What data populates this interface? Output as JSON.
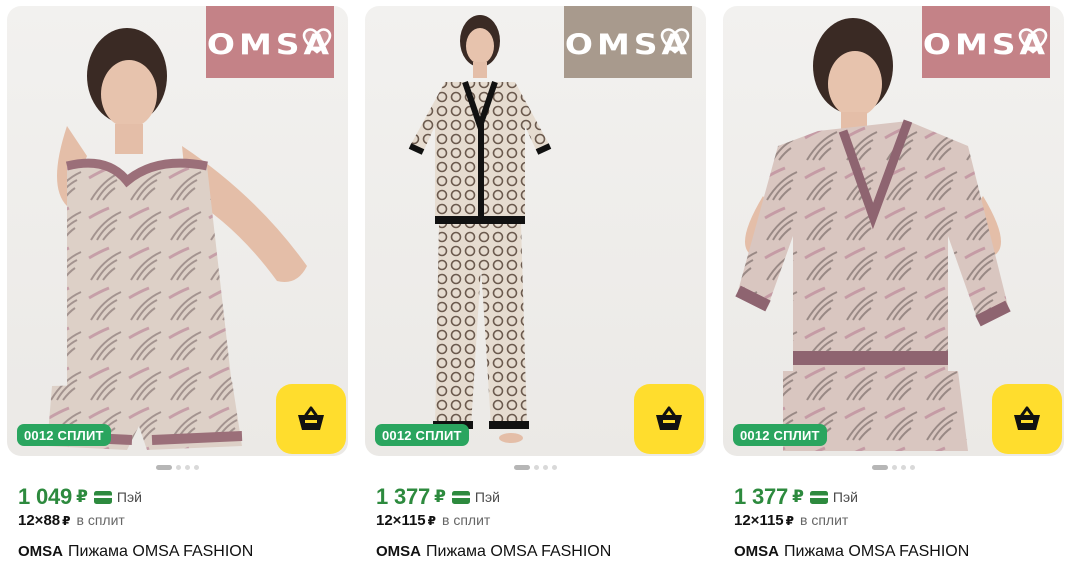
{
  "products": [
    {
      "brand_logo_text": "OMSA",
      "badge_color": "#c48287",
      "split_badge": "0012 СПЛИТ",
      "price": "1 049",
      "currency": "₽",
      "pay_label": "Пэй",
      "split_amount": "12×88",
      "split_currency": "₽",
      "split_text": "в сплит",
      "brand": "OMSA",
      "title": "Пижама OMSA FASHION"
    },
    {
      "brand_logo_text": "OMSA",
      "badge_color": "#a89a8d",
      "split_badge": "0012 СПЛИТ",
      "price": "1 377",
      "currency": "₽",
      "pay_label": "Пэй",
      "split_amount": "12×115",
      "split_currency": "₽",
      "split_text": "в сплит",
      "brand": "OMSA",
      "title": "Пижама OMSA FASHION"
    },
    {
      "brand_logo_text": "OMSA",
      "badge_color": "#c48287",
      "split_badge": "0012 СПЛИТ",
      "price": "1 377",
      "currency": "₽",
      "pay_label": "Пэй",
      "split_amount": "12×115",
      "split_currency": "₽",
      "split_text": "в сплит",
      "brand": "OMSA",
      "title": "Пижама OMSA FASHION"
    }
  ],
  "colors": {
    "price_green": "#2d8a3e",
    "split_badge_green": "#2aa55f",
    "cart_yellow": "#ffdd2d"
  },
  "icons": {
    "favorite": "heart-outline-icon",
    "cart": "basket-icon",
    "pay": "card-icon"
  }
}
